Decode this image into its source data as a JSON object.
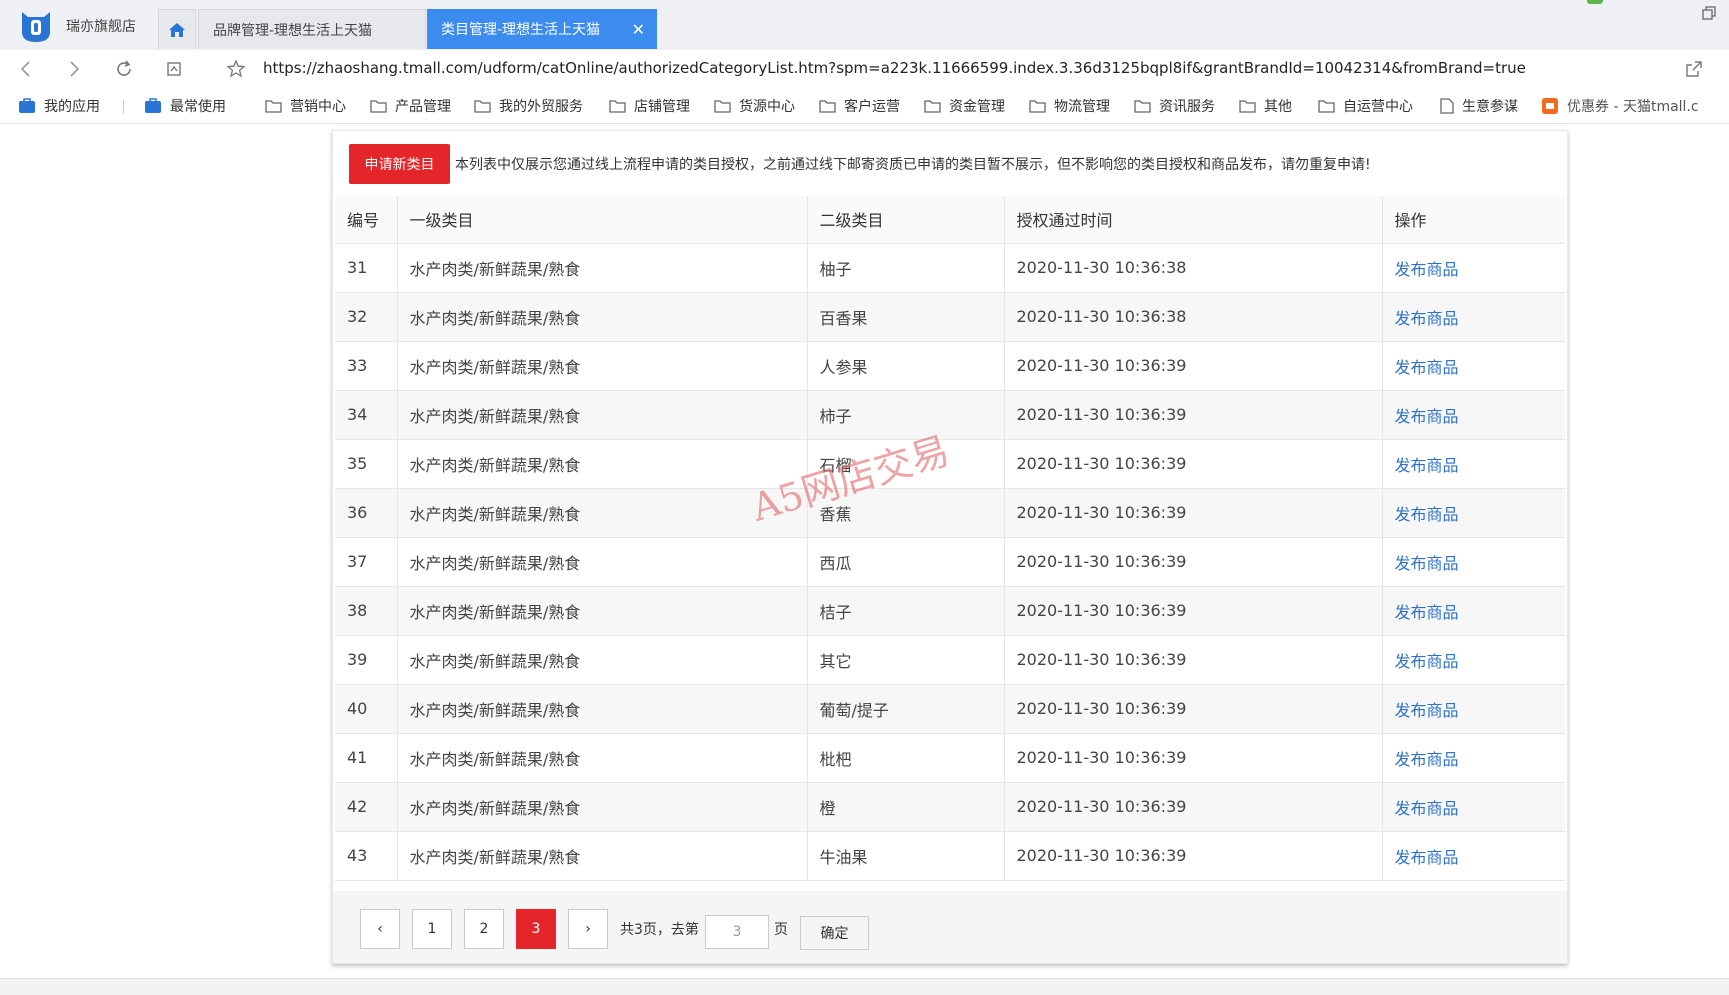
{
  "browser": {
    "store_name": "瑞亦旗舰店",
    "tabs": [
      {
        "label": "品牌管理-理想生活上天猫",
        "active": false
      },
      {
        "label": "类目管理-理想生活上天猫",
        "active": true
      }
    ],
    "tab_close_symbol": "✕",
    "url": "https://zhaoshang.tmall.com/udform/catOnline/authorizedCategoryList.htm?spm=a223k.11666599.index.3.36d3125bqpl8if&grantBrandId=10042314&fromBrand=true"
  },
  "bookmarks": [
    {
      "label": "我的应用",
      "icon": "app-box-icon"
    },
    {
      "label": "最常使用",
      "icon": "app-box-icon"
    },
    {
      "label": "营销中心",
      "icon": "folder-icon"
    },
    {
      "label": "产品管理",
      "icon": "folder-icon"
    },
    {
      "label": "我的外贸服务",
      "icon": "folder-icon"
    },
    {
      "label": "店铺管理",
      "icon": "folder-icon"
    },
    {
      "label": "货源中心",
      "icon": "folder-icon"
    },
    {
      "label": "客户运营",
      "icon": "folder-icon"
    },
    {
      "label": "资金管理",
      "icon": "folder-icon"
    },
    {
      "label": "物流管理",
      "icon": "folder-icon"
    },
    {
      "label": "资讯服务",
      "icon": "folder-icon"
    },
    {
      "label": "其他",
      "icon": "folder-icon"
    },
    {
      "label": "自运营中心",
      "icon": "folder-icon"
    },
    {
      "label": "生意参谋",
      "icon": "page-icon"
    },
    {
      "label": "优惠券 - 天猫tmall.c",
      "icon": "taobao-icon"
    }
  ],
  "main": {
    "apply_button": "申请新类目",
    "notice": "本列表中仅展示您通过线上流程申请的类目授权，之前通过线下邮寄资质已申请的类目暂不展示，但不影响您的类目授权和商品发布，请勿重复申请!",
    "table": {
      "headers": [
        "编号",
        "一级类目",
        "二级类目",
        "授权通过时间",
        "操作"
      ],
      "rows": [
        {
          "no": "31",
          "l1": "水产肉类/新鲜蔬果/熟食",
          "l2": "柚子",
          "time": "2020-11-30 10:36:38",
          "op": "发布商品"
        },
        {
          "no": "32",
          "l1": "水产肉类/新鲜蔬果/熟食",
          "l2": "百香果",
          "time": "2020-11-30 10:36:38",
          "op": "发布商品"
        },
        {
          "no": "33",
          "l1": "水产肉类/新鲜蔬果/熟食",
          "l2": "人参果",
          "time": "2020-11-30 10:36:39",
          "op": "发布商品"
        },
        {
          "no": "34",
          "l1": "水产肉类/新鲜蔬果/熟食",
          "l2": "柿子",
          "time": "2020-11-30 10:36:39",
          "op": "发布商品"
        },
        {
          "no": "35",
          "l1": "水产肉类/新鲜蔬果/熟食",
          "l2": "石榴",
          "time": "2020-11-30 10:36:39",
          "op": "发布商品"
        },
        {
          "no": "36",
          "l1": "水产肉类/新鲜蔬果/熟食",
          "l2": "香蕉",
          "time": "2020-11-30 10:36:39",
          "op": "发布商品"
        },
        {
          "no": "37",
          "l1": "水产肉类/新鲜蔬果/熟食",
          "l2": "西瓜",
          "time": "2020-11-30 10:36:39",
          "op": "发布商品"
        },
        {
          "no": "38",
          "l1": "水产肉类/新鲜蔬果/熟食",
          "l2": "桔子",
          "time": "2020-11-30 10:36:39",
          "op": "发布商品"
        },
        {
          "no": "39",
          "l1": "水产肉类/新鲜蔬果/熟食",
          "l2": "其它",
          "time": "2020-11-30 10:36:39",
          "op": "发布商品"
        },
        {
          "no": "40",
          "l1": "水产肉类/新鲜蔬果/熟食",
          "l2": "葡萄/提子",
          "time": "2020-11-30 10:36:39",
          "op": "发布商品"
        },
        {
          "no": "41",
          "l1": "水产肉类/新鲜蔬果/熟食",
          "l2": "枇杷",
          "time": "2020-11-30 10:36:39",
          "op": "发布商品"
        },
        {
          "no": "42",
          "l1": "水产肉类/新鲜蔬果/熟食",
          "l2": "橙",
          "time": "2020-11-30 10:36:39",
          "op": "发布商品"
        },
        {
          "no": "43",
          "l1": "水产肉类/新鲜蔬果/熟食",
          "l2": "牛油果",
          "time": "2020-11-30 10:36:39",
          "op": "发布商品"
        }
      ]
    },
    "pagination": {
      "prev": "‹",
      "next": "›",
      "pages": [
        "1",
        "2",
        "3"
      ],
      "current": "3",
      "total_text": "共3页，去第",
      "input_value": "3",
      "page_suffix": "页",
      "confirm_label": "确定"
    }
  },
  "watermark": "A5网店交易",
  "colors": {
    "accent_red": "#e4262b",
    "active_tab_blue": "#3c8cf0",
    "link_blue": "#2e72c8"
  }
}
